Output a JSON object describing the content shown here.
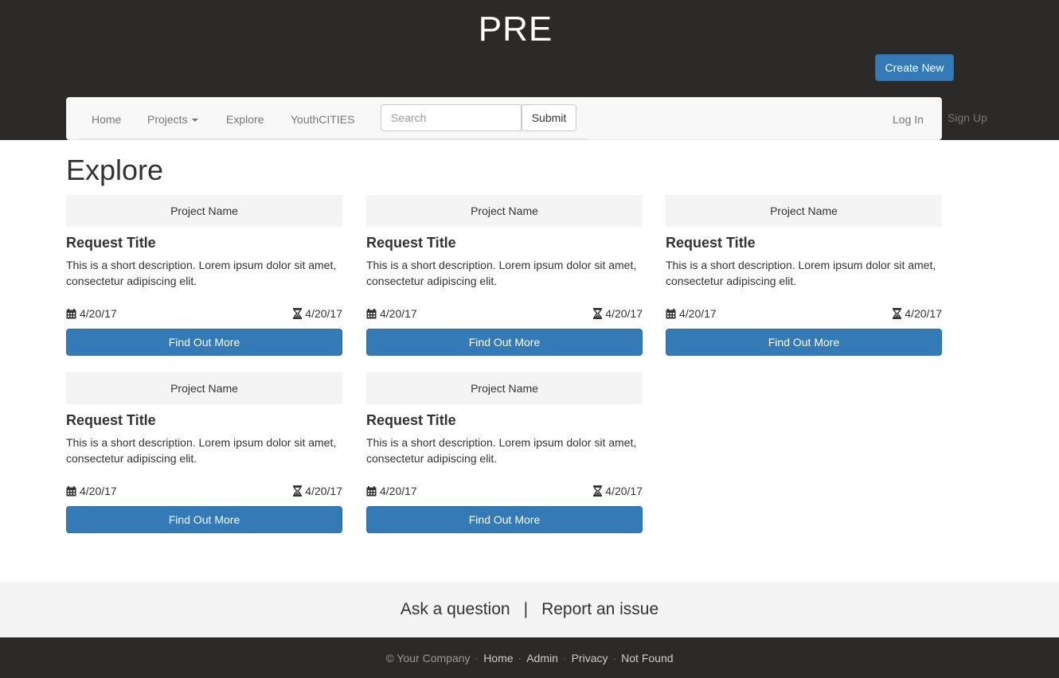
{
  "header": {
    "brand": "PRE",
    "create_label": "Create New"
  },
  "navbar": {
    "items": [
      {
        "label": "Home"
      },
      {
        "label": "Projects"
      },
      {
        "label": "Explore"
      },
      {
        "label": "YouthCITIES"
      }
    ],
    "search_placeholder": "Search",
    "submit_label": "Submit",
    "login_label": "Log In",
    "signup_label": "Sign Up"
  },
  "main": {
    "title": "Explore",
    "cards": [
      {
        "project": "Project Name",
        "title": "Request Title",
        "desc": "This is a short description. Lorem ipsum dolor sit amet, consectetur adipiscing elit.",
        "start": "4/20/17",
        "end": "4/20/17",
        "button": "Find Out More"
      },
      {
        "project": "Project Name",
        "title": "Request Title",
        "desc": "This is a short description. Lorem ipsum dolor sit amet, consectetur adipiscing elit.",
        "start": "4/20/17",
        "end": "4/20/17",
        "button": "Find Out More"
      },
      {
        "project": "Project Name",
        "title": "Request Title",
        "desc": "This is a short description. Lorem ipsum dolor sit amet, consectetur adipiscing elit.",
        "start": "4/20/17",
        "end": "4/20/17",
        "button": "Find Out More"
      },
      {
        "project": "Project Name",
        "title": "Request Title",
        "desc": "This is a short description. Lorem ipsum dolor sit amet, consectetur adipiscing elit.",
        "start": "4/20/17",
        "end": "4/20/17",
        "button": "Find Out More"
      },
      {
        "project": "Project Name",
        "title": "Request Title",
        "desc": "This is a short description. Lorem ipsum dolor sit amet, consectetur adipiscing elit.",
        "start": "4/20/17",
        "end": "4/20/17",
        "button": "Find Out More"
      }
    ]
  },
  "help": {
    "ask": "Ask a question",
    "separator": "|",
    "report": "Report an issue"
  },
  "footer": {
    "copyright": "© Your Company",
    "separator": "·",
    "links": [
      {
        "label": "Home"
      },
      {
        "label": "Admin"
      },
      {
        "label": "Privacy"
      },
      {
        "label": "Not Found"
      }
    ]
  },
  "icons": {
    "start_date": "calendar-icon",
    "end_date": "hourglass-icon"
  },
  "colors": {
    "header_bg": "#2b2a29",
    "primary": "#337ab7",
    "navbar_bg": "#f8f8f8",
    "panel_bg": "#f4f4f4"
  }
}
